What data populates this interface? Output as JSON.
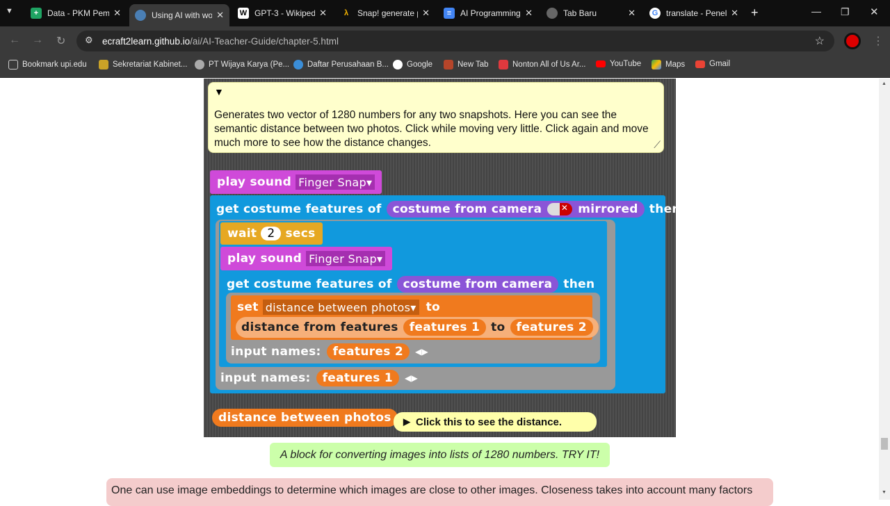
{
  "browser": {
    "tabs": [
      {
        "label": "Data - PKM Pem",
        "active": false
      },
      {
        "label": "Using AI with wo",
        "active": true
      },
      {
        "label": "GPT-3 - Wikiped",
        "active": false
      },
      {
        "label": "Snap! generate p",
        "active": false
      },
      {
        "label": "AI Programming",
        "active": false
      },
      {
        "label": "Tab Baru",
        "active": false
      },
      {
        "label": "translate - Penel",
        "active": false
      }
    ],
    "url_host": "ecraft2learn.github.io",
    "url_path": "/ai/AI-Teacher-Guide/chapter-5.html",
    "bookmarks": [
      "Bookmark upi.edu",
      "Sekretariat Kabinet...",
      "PT Wijaya Karya (Pe...",
      "Daftar Perusahaan B...",
      "Google",
      "New Tab",
      "Nonton All of Us Ar...",
      "YouTube",
      "Maps",
      "Gmail"
    ]
  },
  "snap": {
    "comment": "Generates two vector of 1280 numbers for any two snapshots. Here you can see the semantic distance between two photos. Click while moving very little. Click again and move much more to see how the distance changes.",
    "play_sound": "play sound",
    "sound_name": "Finger Snap",
    "get_features": "get costume features of",
    "costume_from_camera": "costume from camera",
    "mirrored": "mirrored",
    "then": "then",
    "wait": "wait",
    "wait_value": "2",
    "secs": "secs",
    "set": "set",
    "variable": "distance between photos",
    "to": "to",
    "distance_from_features": "distance from features",
    "features1": "features 1",
    "features2": "features 2",
    "input_names": "input names:",
    "reporter": "distance between photos",
    "reporter_comment": "Click this to see the distance."
  },
  "caption": "A block for converting images into lists of 1280 numbers. TRY IT!",
  "paragraph": "One can use image embeddings to determine which images are close to other images. Closeness takes into account many factors"
}
